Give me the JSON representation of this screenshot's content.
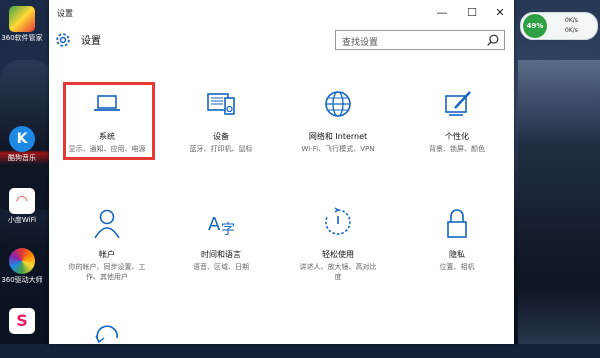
{
  "desktop": {
    "icons": [
      {
        "label": "360软件管家",
        "color": "#2e7d32"
      },
      {
        "label": "酷狗音乐",
        "color": "#1e88e5"
      },
      {
        "label": "小度WiFi",
        "color": "#e53935"
      },
      {
        "label": "360驱动大师",
        "color": "#fb8c00"
      },
      {
        "label": "",
        "color": "#e91e63"
      }
    ]
  },
  "widget": {
    "percent": "49%",
    "up": "0K/s",
    "down": "0K/s"
  },
  "window": {
    "title": "设置",
    "minimize": "—",
    "maximize": "☐",
    "close": "✕",
    "header": {
      "title": "设置"
    },
    "search": {
      "placeholder": "查找设置"
    }
  },
  "tiles": [
    {
      "key": "system",
      "name": "系统",
      "desc": "显示、通知、应用、电源",
      "icon": "laptop-icon"
    },
    {
      "key": "devices",
      "name": "设备",
      "desc": "蓝牙、打印机、鼠标",
      "icon": "devices-icon"
    },
    {
      "key": "network",
      "name": "网络和 Internet",
      "desc": "Wi-Fi、飞行模式、VPN",
      "icon": "globe-icon"
    },
    {
      "key": "personalization",
      "name": "个性化",
      "desc": "背景、锁屏、颜色",
      "icon": "brush-icon"
    },
    {
      "key": "accounts",
      "name": "帐户",
      "desc": "你的帐户、同步设置、工作、其他用户",
      "icon": "person-icon"
    },
    {
      "key": "time",
      "name": "时间和语言",
      "desc": "语音、区域、日期",
      "icon": "language-icon"
    },
    {
      "key": "ease",
      "name": "轻松使用",
      "desc": "讲述人、放大镜、高对比度",
      "icon": "ease-of-access-icon"
    },
    {
      "key": "privacy",
      "name": "隐私",
      "desc": "位置、相机",
      "icon": "lock-icon"
    },
    {
      "key": "update",
      "name": "",
      "desc": "",
      "icon": "update-icon"
    }
  ],
  "colors": {
    "accent": "#1565c0",
    "highlight": "#e53935",
    "icon": "#1565c0"
  }
}
